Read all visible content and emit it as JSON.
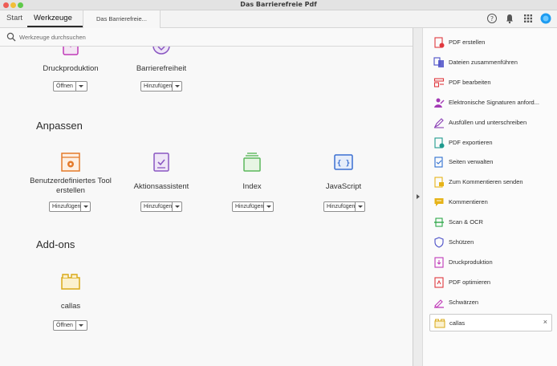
{
  "window": {
    "title": "Das Barrierefreie Pdf"
  },
  "tabs": {
    "start": "Start",
    "tools": "Werkzeuge",
    "document": "Das Barrierefreie..."
  },
  "search": {
    "placeholder": "Werkzeuge durchsuchen"
  },
  "top_tools": [
    {
      "label": "Druckproduktion",
      "button": "Öffnen"
    },
    {
      "label": "Barrierefreiheit",
      "button": "Hinzufügen"
    }
  ],
  "customize": {
    "title": "Anpassen",
    "tools": [
      {
        "label": "Benutzerdefiniertes Tool erstellen",
        "button": "Hinzufügen"
      },
      {
        "label": "Aktionsassistent",
        "button": "Hinzufügen"
      },
      {
        "label": "Index",
        "button": "Hinzufügen"
      },
      {
        "label": "JavaScript",
        "button": "Hinzufügen"
      }
    ]
  },
  "addons": {
    "title": "Add-ons",
    "tools": [
      {
        "label": "callas",
        "button": "Öffnen"
      }
    ]
  },
  "right_panel": {
    "items": [
      {
        "label": "PDF erstellen",
        "icon": "pdf-create-icon",
        "color": "#e0383e"
      },
      {
        "label": "Dateien zusammenführen",
        "icon": "combine-files-icon",
        "color": "#4b4fc7"
      },
      {
        "label": "PDF bearbeiten",
        "icon": "edit-pdf-icon",
        "color": "#e0383e"
      },
      {
        "label": "Elektronische Signaturen anford...",
        "icon": "request-signature-icon",
        "color": "#a33ab5"
      },
      {
        "label": "Ausfüllen und unterschreiben",
        "icon": "fill-sign-icon",
        "color": "#8a3fb5"
      },
      {
        "label": "PDF exportieren",
        "icon": "export-pdf-icon",
        "color": "#1f9a8e"
      },
      {
        "label": "Seiten verwalten",
        "icon": "organize-pages-icon",
        "color": "#2f6fd0"
      },
      {
        "label": "Zum Kommentieren senden",
        "icon": "send-comment-icon",
        "color": "#e6b318"
      },
      {
        "label": "Kommentieren",
        "icon": "comment-icon",
        "color": "#e6b318"
      },
      {
        "label": "Scan & OCR",
        "icon": "scan-icon",
        "color": "#2fa84a"
      },
      {
        "label": "Schützen",
        "icon": "protect-icon",
        "color": "#4b4fc7"
      },
      {
        "label": "Druckproduktion",
        "icon": "print-production-icon",
        "color": "#c03ab8"
      },
      {
        "label": "PDF optimieren",
        "icon": "optimize-pdf-icon",
        "color": "#e0383e"
      },
      {
        "label": "Schwärzen",
        "icon": "redact-icon",
        "color": "#c03ab8"
      }
    ],
    "selected": {
      "label": "callas",
      "icon": "callas-folder-icon",
      "close": "×"
    }
  },
  "colors": {
    "accent": "#1d9bf0",
    "orange": "#e47a2a",
    "purple": "#8a57c2",
    "green": "#5cb85c",
    "blue": "#3a6fd1",
    "yellow": "#e8c547"
  }
}
